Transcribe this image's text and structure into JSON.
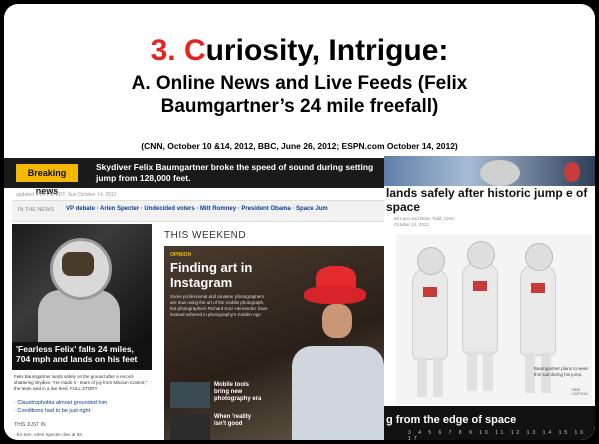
{
  "slide": {
    "title_prefix": "3. ",
    "title_red": "C",
    "title_rest": "uriosity, Intrigue:",
    "subtitle_line1": "A.  Online News and Live Feeds (Felix",
    "subtitle_line2": "Baumgartner’s 24 mile freefall)",
    "citation": "(CNN, October 10 &14, 2012, BBC, June 26, 2012; ESPN.com October 14, 2012)"
  },
  "cnn": {
    "breaking_label": "Breaking news",
    "breaking_text": "Skydiver Felix Baumgartner broke the speed of sound during setting jump from 128,000 feet.",
    "updated": "updated 4:34 PM EDT, Sun October 14, 2012",
    "in_the_news": "IN THE NEWS",
    "topics": "VP debate · Arlen Specter · Undecided voters · Mitt Romney · President Obama · Space Jum",
    "headline": "'Fearless Felix' falls 24 miles, 704 mph and lands on his feet",
    "body": "Felix Baumgartner lands safely on the ground after a record-shattering skydive. \"He made it - tears of joy from Mission Control,\" the team said in a live feed. FULL STORY",
    "link1": "· Claustrophobia almost grounded him",
    "link2": "· Conditions had to be just right",
    "just_in": "THIS JUST IN",
    "ticker": "· Ex-Sen. Arlen Specter dies at 82",
    "weekend": "THIS WEEKEND",
    "opinion": "OPINION",
    "feature_title": "Finding art in Instagram",
    "feature_desc": "Some professional and amateur photographers are now using the art of the mobile photograph, but photographers Richard Koci Hernandez have instead ushered in photography's Golden Age",
    "thumb1_title": "Mobile tools bring new photography era",
    "thumb2_title": "When 'reality isn't good"
  },
  "bbc": {
    "headline": "lands safely after historic jump e of space",
    "byline": "att Lavo and Brian Todd, CNN",
    "date": "October 14, 2012",
    "caption": "Baumgartner plans to wear this suit during his jump.",
    "hide_caption": "HIDE CAPTION",
    "bottom_title": "g from the edge of space",
    "page_numbers": "3 4 5 6 7 8 9 10 11 12 13 14 15 16 17"
  }
}
